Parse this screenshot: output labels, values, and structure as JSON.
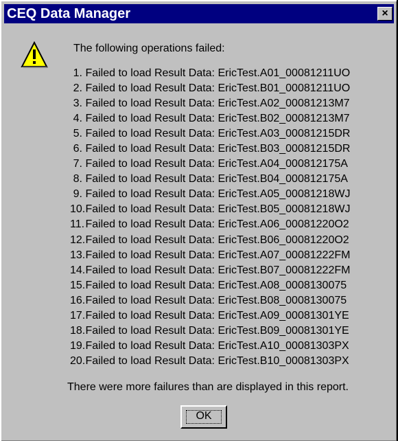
{
  "window": {
    "title": "CEQ Data Manager",
    "close_glyph": "×"
  },
  "message": {
    "header": "The following operations failed:",
    "items": [
      {
        "num": "1.",
        "text": "Failed to load Result Data: EricTest.A01_00081211UO"
      },
      {
        "num": "2.",
        "text": "Failed to load Result Data: EricTest.B01_00081211UO"
      },
      {
        "num": "3.",
        "text": "Failed to load Result Data: EricTest.A02_00081213M7"
      },
      {
        "num": "4.",
        "text": "Failed to load Result Data: EricTest.B02_00081213M7"
      },
      {
        "num": "5.",
        "text": "Failed to load Result Data: EricTest.A03_00081215DR"
      },
      {
        "num": "6.",
        "text": "Failed to load Result Data: EricTest.B03_00081215DR"
      },
      {
        "num": "7.",
        "text": "Failed to load Result Data: EricTest.A04_000812175A"
      },
      {
        "num": "8.",
        "text": "Failed to load Result Data: EricTest.B04_000812175A"
      },
      {
        "num": "9.",
        "text": "Failed to load Result Data: EricTest.A05_00081218WJ"
      },
      {
        "num": "10.",
        "text": "Failed to load Result Data: EricTest.B05_00081218WJ"
      },
      {
        "num": "11.",
        "text": "Failed to load Result Data: EricTest.A06_00081220O2"
      },
      {
        "num": "12.",
        "text": "Failed to load Result Data: EricTest.B06_00081220O2"
      },
      {
        "num": "13.",
        "text": "Failed to load Result Data: EricTest.A07_00081222FM"
      },
      {
        "num": "14.",
        "text": "Failed to load Result Data: EricTest.B07_00081222FM"
      },
      {
        "num": "15.",
        "text": "Failed to load Result Data: EricTest.A08_0008130075"
      },
      {
        "num": "16.",
        "text": "Failed to load Result Data: EricTest.B08_0008130075"
      },
      {
        "num": "17.",
        "text": "Failed to load Result Data: EricTest.A09_00081301YE"
      },
      {
        "num": "18.",
        "text": "Failed to load Result Data: EricTest.B09_00081301YE"
      },
      {
        "num": "19.",
        "text": "Failed to load Result Data: EricTest.A10_00081303PX"
      },
      {
        "num": "20.",
        "text": "Failed to load Result Data: EricTest.B10_00081303PX"
      }
    ],
    "footer": "There were more failures than are displayed in this report."
  },
  "buttons": {
    "ok_label": "OK"
  },
  "icons": {
    "warning": "warning-icon",
    "close": "close-icon"
  },
  "colors": {
    "titlebar": "#000080",
    "dialog_bg": "#c0c0c0",
    "warning_yellow": "#ffff00"
  }
}
